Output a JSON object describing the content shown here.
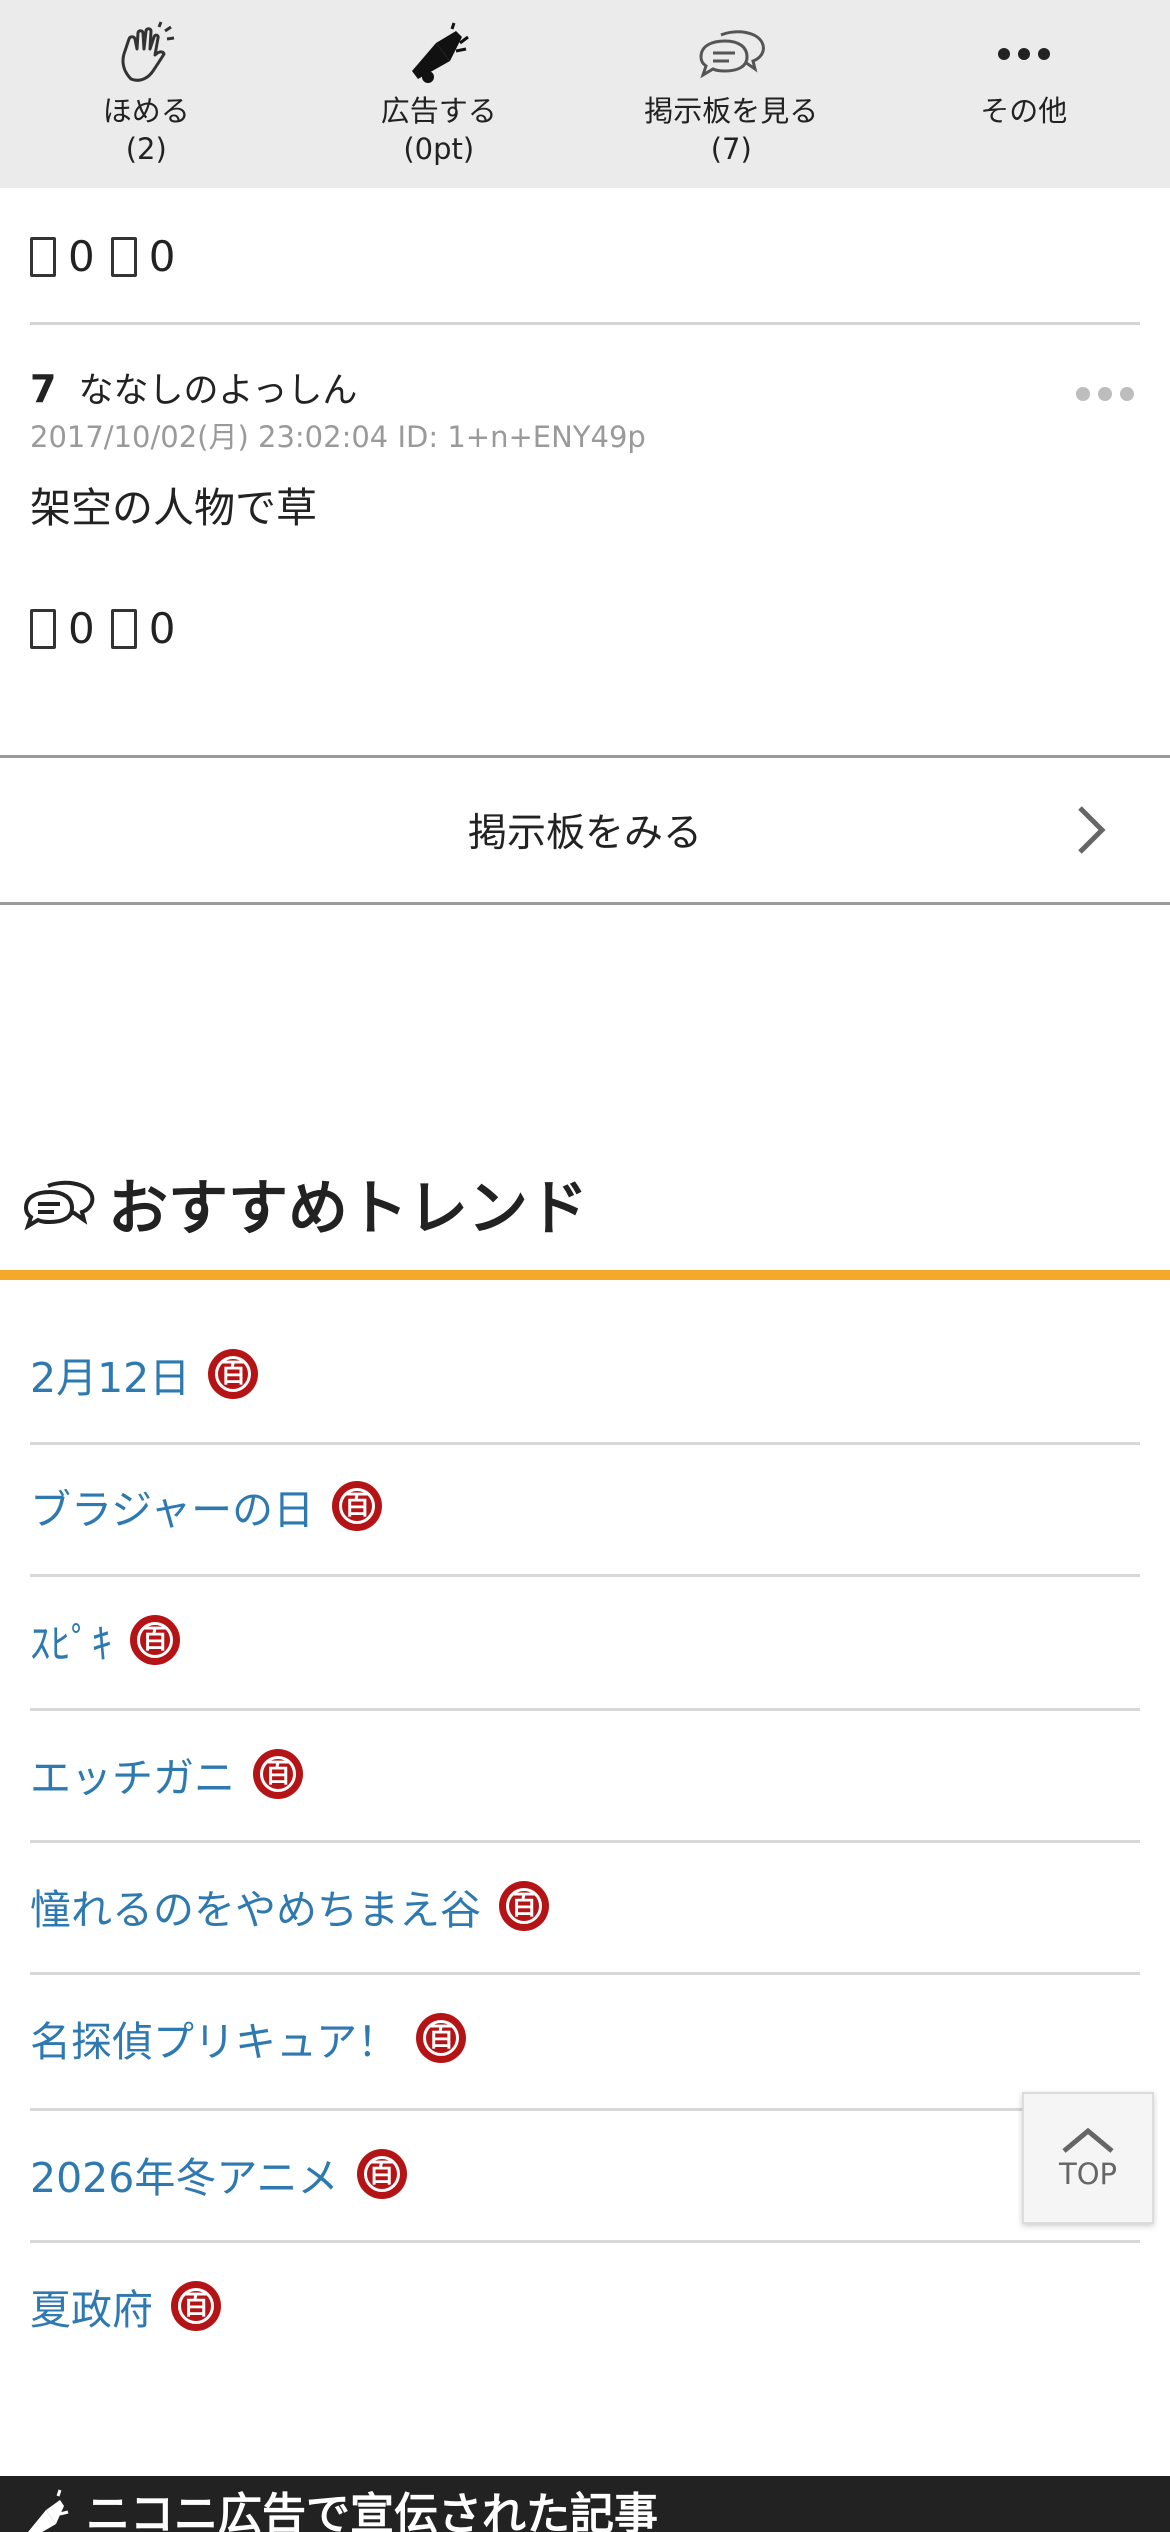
{
  "actionbar": {
    "items": [
      {
        "label": "ほめる",
        "count": "(2)",
        "icon": "clap-icon"
      },
      {
        "label": "広告する",
        "count": "(0pt)",
        "icon": "megaphone-icon"
      },
      {
        "label": "掲示板を見る",
        "count": "(7)",
        "icon": "chat-bubbles-icon"
      },
      {
        "label": "その他",
        "count": "",
        "icon": "more-dots-icon"
      }
    ]
  },
  "reactions_top": {
    "good": "0",
    "bad": "0"
  },
  "post": {
    "number": "7",
    "name": "ななしのよっしん",
    "meta": "2017/10/02(月) 23:02:04 ID: 1+n+ENY49p",
    "body": "架空の人物で草",
    "reactions": {
      "good": "0",
      "bad": "0"
    }
  },
  "view_board": {
    "label": "掲示板をみる"
  },
  "trend": {
    "title": "おすすめトレンド",
    "badge_char": "百",
    "items": [
      {
        "label": "2月12日"
      },
      {
        "label": "ブラジャーの日"
      },
      {
        "label": "ｽﾋﾟｷ"
      },
      {
        "label": "エッチガニ"
      },
      {
        "label": "憧れるのをやめちまえ谷"
      },
      {
        "label": "名探偵プリキュア！"
      },
      {
        "label": "2026年冬アニメ"
      },
      {
        "label": "夏政府"
      }
    ]
  },
  "top_button": {
    "label": "TOP"
  },
  "footer": {
    "text": "ニコニ広告で宣伝された記事"
  },
  "colors": {
    "accent": "#f5a82a",
    "link": "#2e7ab0",
    "badge": "#b51416",
    "bar_bg": "#ebebeb"
  }
}
